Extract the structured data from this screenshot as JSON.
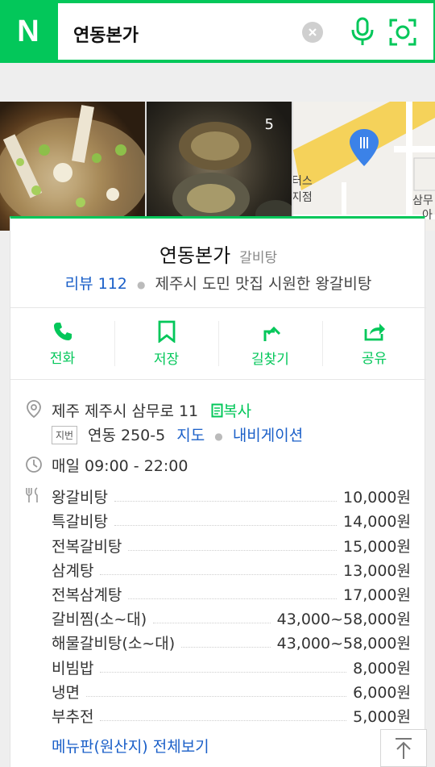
{
  "search": {
    "logo": "N",
    "query": "연동본가"
  },
  "photos": {
    "count_badge": "5",
    "map_labels": [
      "터스",
      "지점",
      "삼무",
      "아"
    ]
  },
  "place": {
    "name": "연동본가",
    "category": "갈비탕",
    "review_label": "리뷰 112",
    "description": "제주시 도민 맛집 시원한 왕갈비탕"
  },
  "actions": [
    {
      "label": "전화",
      "icon": "phone-icon"
    },
    {
      "label": "저장",
      "icon": "bookmark-icon"
    },
    {
      "label": "길찾기",
      "icon": "directions-icon"
    },
    {
      "label": "공유",
      "icon": "share-icon"
    }
  ],
  "info": {
    "address": "제주 제주시 삼무로 11",
    "copy_label": "복사",
    "jibun_badge": "지번",
    "jibun_address": "연동 250-5",
    "map_link": "지도",
    "navi_link": "내비게이션",
    "hours": "매일 09:00 - 22:00"
  },
  "menu": [
    {
      "name": "왕갈비탕",
      "price": "10,000원"
    },
    {
      "name": "특갈비탕",
      "price": "14,000원"
    },
    {
      "name": "전복갈비탕",
      "price": "15,000원"
    },
    {
      "name": "삼계탕",
      "price": "13,000원"
    },
    {
      "name": "전복삼계탕",
      "price": "17,000원"
    },
    {
      "name": "갈비찜(소~대)",
      "price": "43,000~58,000원"
    },
    {
      "name": "해물갈비탕(소~대)",
      "price": "43,000~58,000원"
    },
    {
      "name": "비빔밥",
      "price": "8,000원"
    },
    {
      "name": "냉면",
      "price": "6,000원"
    },
    {
      "name": "부추전",
      "price": "5,000원"
    }
  ],
  "menu_more": "메뉴판(원산지) 전체보기",
  "colors": {
    "brand": "#03c75a",
    "link": "#1a5fc8"
  }
}
